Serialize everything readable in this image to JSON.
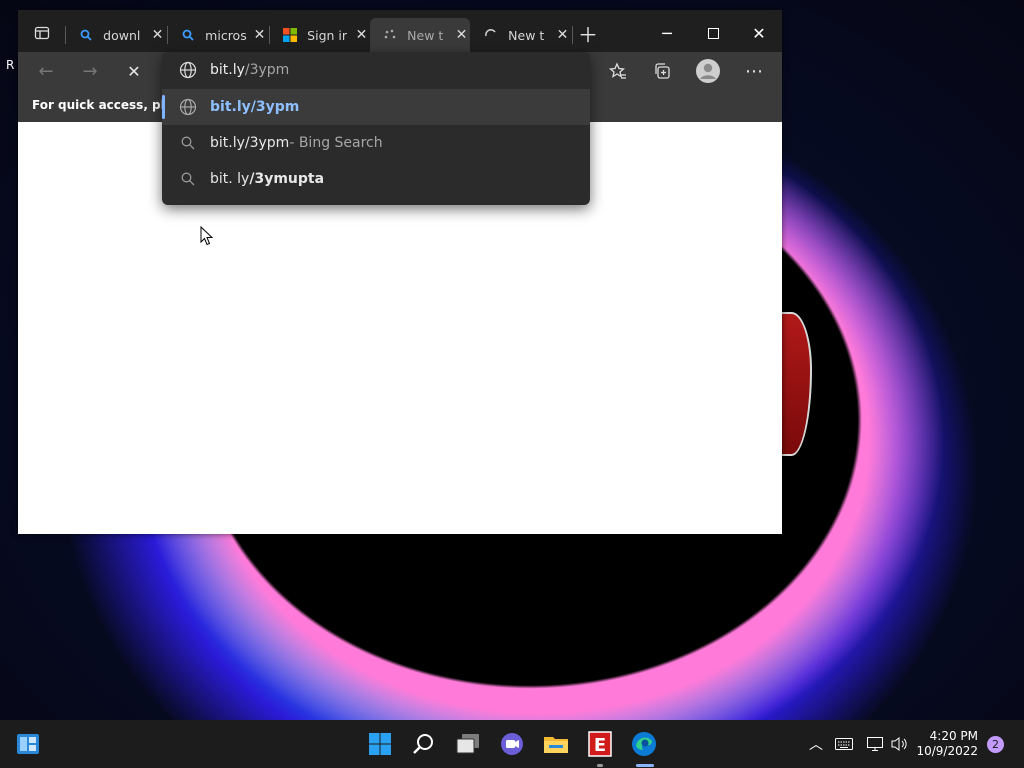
{
  "desktop": {
    "partial_label": "R"
  },
  "browser": {
    "tabs": [
      {
        "label": "downl",
        "icon": "search-icon"
      },
      {
        "label": "micros",
        "icon": "search-icon"
      },
      {
        "label": "Sign ir",
        "icon": "microsoft-logo-icon"
      },
      {
        "label": "New t",
        "icon": "loading-icon",
        "active": true
      },
      {
        "label": "New t",
        "icon": "loading-icon"
      }
    ],
    "favorites_bar_text": "For quick access, place y",
    "address": {
      "typed": "bit.ly",
      "suggested": "/3ypm"
    },
    "suggestions": [
      {
        "icon": "globe-icon",
        "prefix": "",
        "main": "bit.ly/3ypm",
        "suffix": ""
      },
      {
        "icon": "search-icon",
        "prefix": "",
        "main": "bit.ly/3ypm",
        "suffix": " - Bing Search"
      },
      {
        "icon": "search-icon",
        "prefix": "bit. ly",
        "main": "/3ymupta",
        "suffix": ""
      }
    ]
  },
  "taskbar": {
    "time": "4:20 PM",
    "date": "10/9/2022",
    "notification_count": "2"
  }
}
